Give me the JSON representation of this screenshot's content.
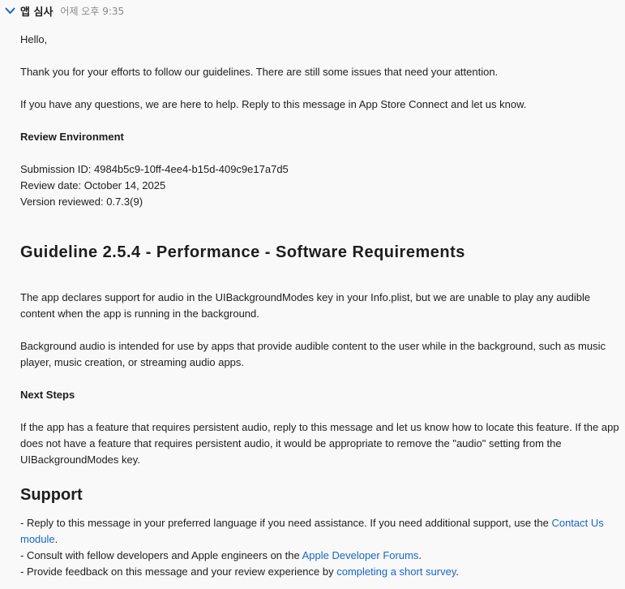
{
  "header": {
    "sender": "앱 심사",
    "timestamp": "어제 오후 9:35"
  },
  "message": {
    "greeting": "Hello,",
    "intro": "Thank you for your efforts to follow our guidelines. There are still some issues that need your attention.",
    "help": "If you have any questions, we are here to help. Reply to this message in App Store Connect and let us know.",
    "review_env_heading": "Review Environment",
    "submission_id": "Submission ID: 4984b5c9-10ff-4ee4-b15d-409c9e17a7d5",
    "review_date": "Review date: October 14, 2025",
    "version_reviewed": "Version reviewed: 0.7.3(9)",
    "guideline_heading": "Guideline 2.5.4 - Performance - Software Requirements",
    "issue_p1": "The app declares support for audio in the UIBackgroundModes key in your Info.plist, but we are unable to play any audible content when the app is running in the background.",
    "issue_p2": "Background audio is intended for use by apps that provide audible content to the user while in the background, such as music player, music creation, or streaming audio apps.",
    "next_steps_heading": "Next Steps",
    "next_steps_text": "If the app has a feature that requires persistent audio, reply to this message and let us know how to locate this feature. If the app does not have a feature that requires persistent audio, it would be appropriate to remove the \"audio\" setting from the UIBackgroundModes key.",
    "support_heading": "Support",
    "support_1_prefix": "- Reply to this message in your preferred language if you need assistance. If you need additional support, use the ",
    "support_1_link": "Contact Us module",
    "support_1_suffix": ".",
    "support_2_prefix": "- Consult with fellow developers and Apple engineers on the ",
    "support_2_link": "Apple Developer Forums",
    "support_2_suffix": ".",
    "support_3_prefix": "- Provide feedback on this message and your review experience by ",
    "support_3_link": "completing a short survey",
    "support_3_suffix": "."
  },
  "colors": {
    "link": "#1766c7",
    "chevron": "#1766c7",
    "background": "#f9f9f9"
  },
  "icons": {
    "chevron": "chevron-down-icon"
  }
}
